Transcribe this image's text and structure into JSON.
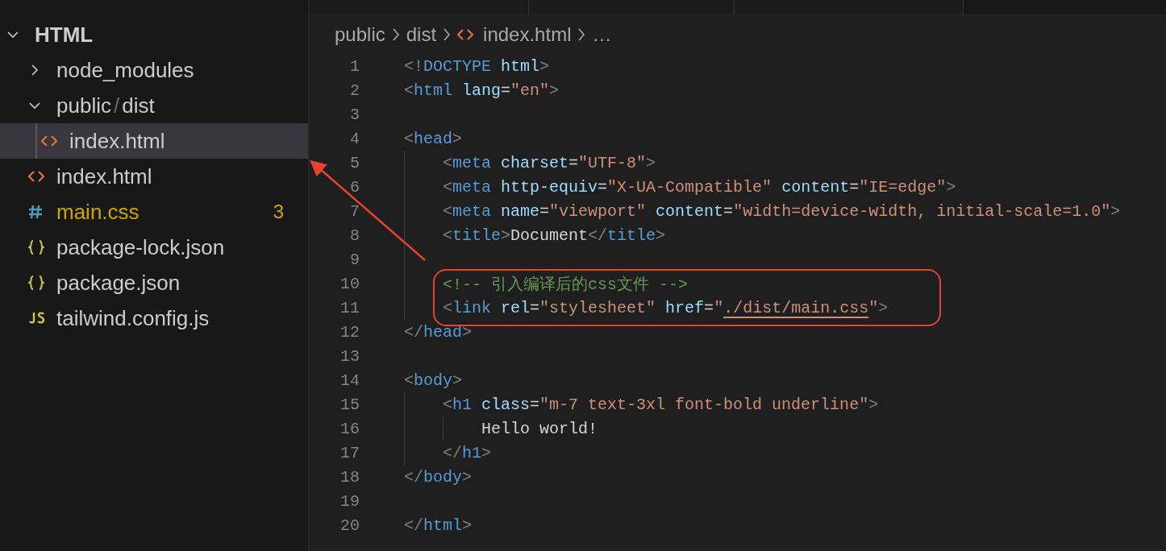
{
  "explorer": {
    "title": "HTML",
    "expanded": true,
    "items": [
      {
        "kind": "folder",
        "name": "node_modules",
        "expanded": false,
        "selected": false
      },
      {
        "kind": "folder",
        "name": "public",
        "separator": "/",
        "name_rest": "dist",
        "expanded": true,
        "selected": false,
        "children": [
          {
            "kind": "html",
            "name": "index.html",
            "selected": true
          }
        ]
      },
      {
        "kind": "html",
        "name": "index.html",
        "selected": false
      },
      {
        "kind": "css",
        "name": "main.css",
        "badge": "3",
        "selected": false
      },
      {
        "kind": "json",
        "name": "package-lock.json",
        "selected": false
      },
      {
        "kind": "json",
        "name": "package.json",
        "selected": false
      },
      {
        "kind": "js",
        "name": "tailwind.config.js",
        "selected": false
      }
    ]
  },
  "breadcrumb": [
    {
      "kind": "folder",
      "label": "public"
    },
    {
      "kind": "folder",
      "label": "dist"
    },
    {
      "kind": "html",
      "label": "index.html"
    },
    {
      "kind": "more",
      "label": "…"
    }
  ],
  "code": {
    "lines": [
      {
        "number": "1",
        "tokens": [
          {
            "t": "<!",
            "kind": "punct"
          },
          {
            "t": "DOCTYPE",
            "kind": "tag"
          },
          {
            "t": " html",
            "kind": "attr"
          },
          {
            "t": ">",
            "kind": "punct"
          }
        ]
      },
      {
        "number": "2",
        "tokens": [
          {
            "t": "<",
            "kind": "punct"
          },
          {
            "t": "html",
            "kind": "tag"
          },
          {
            "t": " lang",
            "kind": "attr"
          },
          {
            "t": "=",
            "kind": "text"
          },
          {
            "t": "\"en\"",
            "kind": "str"
          },
          {
            "t": ">",
            "kind": "punct"
          }
        ]
      },
      {
        "number": "3"
      },
      {
        "number": "4",
        "tokens": [
          {
            "t": "<",
            "kind": "punct"
          },
          {
            "t": "head",
            "kind": "tag"
          },
          {
            "t": ">",
            "kind": "punct"
          }
        ]
      },
      {
        "number": "5",
        "indented": true,
        "tokens": [
          {
            "t": "<",
            "kind": "punct"
          },
          {
            "t": "meta",
            "kind": "tag"
          },
          {
            "t": " charset",
            "kind": "attr"
          },
          {
            "t": "=",
            "kind": "text"
          },
          {
            "t": "\"UTF-8\"",
            "kind": "str"
          },
          {
            "t": ">",
            "kind": "punct"
          }
        ]
      },
      {
        "number": "6",
        "indented": true,
        "tokens": [
          {
            "t": "<",
            "kind": "punct"
          },
          {
            "t": "meta",
            "kind": "tag"
          },
          {
            "t": " http-equiv",
            "kind": "attr"
          },
          {
            "t": "=",
            "kind": "text"
          },
          {
            "t": "\"X-UA-Compatible\"",
            "kind": "str"
          },
          {
            "t": " content",
            "kind": "attr"
          },
          {
            "t": "=",
            "kind": "text"
          },
          {
            "t": "\"IE=edge\"",
            "kind": "str"
          },
          {
            "t": ">",
            "kind": "punct"
          }
        ]
      },
      {
        "number": "7",
        "indented": true,
        "tokens": [
          {
            "t": "<",
            "kind": "punct"
          },
          {
            "t": "meta",
            "kind": "tag"
          },
          {
            "t": " name",
            "kind": "attr"
          },
          {
            "t": "=",
            "kind": "text"
          },
          {
            "t": "\"viewport\"",
            "kind": "str"
          },
          {
            "t": " content",
            "kind": "attr"
          },
          {
            "t": "=",
            "kind": "text"
          },
          {
            "t": "\"width=device-width, initial-scale=1.0\"",
            "kind": "str"
          },
          {
            "t": ">",
            "kind": "punct"
          }
        ]
      },
      {
        "number": "8",
        "indented": true,
        "tokens": [
          {
            "t": "<",
            "kind": "punct"
          },
          {
            "t": "title",
            "kind": "tag"
          },
          {
            "t": ">",
            "kind": "punct"
          },
          {
            "t": "Document",
            "kind": "text"
          },
          {
            "t": "</",
            "kind": "punct"
          },
          {
            "t": "title",
            "kind": "tag"
          },
          {
            "t": ">",
            "kind": "punct"
          }
        ]
      },
      {
        "number": "9",
        "indented": true
      },
      {
        "number": "10",
        "indented": true,
        "framed": true,
        "tokens": [
          {
            "t": "<!-- 引入编译后的css文件 -->",
            "kind": "comment"
          }
        ]
      },
      {
        "number": "11",
        "indented": true,
        "framed": true,
        "tokens": [
          {
            "t": "<",
            "kind": "punct"
          },
          {
            "t": "link",
            "kind": "tag"
          },
          {
            "t": " rel",
            "kind": "attr"
          },
          {
            "t": "=",
            "kind": "text"
          },
          {
            "t": "\"stylesheet\"",
            "kind": "str"
          },
          {
            "t": " href",
            "kind": "attr"
          },
          {
            "t": "=",
            "kind": "text"
          },
          {
            "t": "\"",
            "kind": "str"
          },
          {
            "t": "./dist/main.css",
            "kind": "link"
          },
          {
            "t": "\"",
            "kind": "str"
          },
          {
            "t": ">",
            "kind": "punct"
          }
        ]
      },
      {
        "number": "12",
        "tokens": [
          {
            "t": "</",
            "kind": "punct"
          },
          {
            "t": "head",
            "kind": "tag"
          },
          {
            "t": ">",
            "kind": "punct"
          }
        ]
      },
      {
        "number": "13"
      },
      {
        "number": "14",
        "tokens": [
          {
            "t": "<",
            "kind": "punct"
          },
          {
            "t": "body",
            "kind": "tag"
          },
          {
            "t": ">",
            "kind": "punct"
          }
        ]
      },
      {
        "number": "15",
        "indented": true,
        "tokens": [
          {
            "t": "<",
            "kind": "punct"
          },
          {
            "t": "h1",
            "kind": "tag"
          },
          {
            "t": " class",
            "kind": "attr"
          },
          {
            "t": "=",
            "kind": "text"
          },
          {
            "t": "\"m-7 text-3xl font-bold underline\"",
            "kind": "str"
          },
          {
            "t": ">",
            "kind": "punct"
          }
        ]
      },
      {
        "number": "16",
        "indented": true,
        "nested": true,
        "tokens": [
          {
            "t": "Hello world!",
            "kind": "text"
          }
        ]
      },
      {
        "number": "17",
        "indented": true,
        "tokens": [
          {
            "t": "</",
            "kind": "punct"
          },
          {
            "t": "h1",
            "kind": "tag"
          },
          {
            "t": ">",
            "kind": "punct"
          }
        ]
      },
      {
        "number": "18",
        "tokens": [
          {
            "t": "</",
            "kind": "punct"
          },
          {
            "t": "body",
            "kind": "tag"
          },
          {
            "t": ">",
            "kind": "punct"
          }
        ]
      },
      {
        "number": "19"
      },
      {
        "number": "20",
        "tokens": [
          {
            "t": "</",
            "kind": "punct"
          },
          {
            "t": "html",
            "kind": "tag"
          },
          {
            "t": ">",
            "kind": "punct"
          }
        ]
      }
    ]
  },
  "annotation_arrow": true
}
